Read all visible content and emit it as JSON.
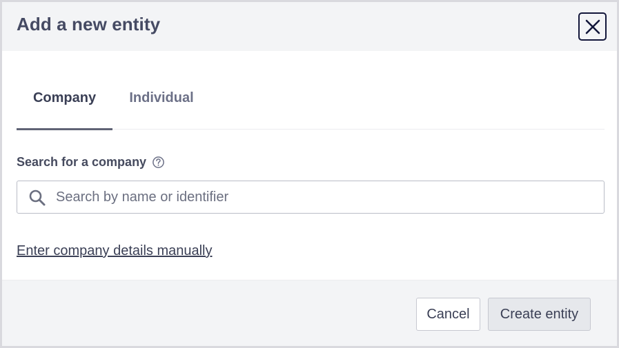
{
  "dialog": {
    "title": "Add a new entity",
    "close_icon": "close-icon"
  },
  "tabs": [
    {
      "label": "Company",
      "active": true
    },
    {
      "label": "Individual",
      "active": false
    }
  ],
  "search": {
    "label": "Search for a company",
    "help_icon": "question-circle-icon",
    "search_icon": "search-icon",
    "placeholder": "Search by name or identifier",
    "value": ""
  },
  "manual_link": "Enter company details manually",
  "footer": {
    "cancel_label": "Cancel",
    "create_label": "Create entity"
  },
  "colors": {
    "header_bg": "#f3f4f6",
    "text_primary": "#3a3f55",
    "text_muted": "#6c7087",
    "close_border": "#12163a"
  }
}
